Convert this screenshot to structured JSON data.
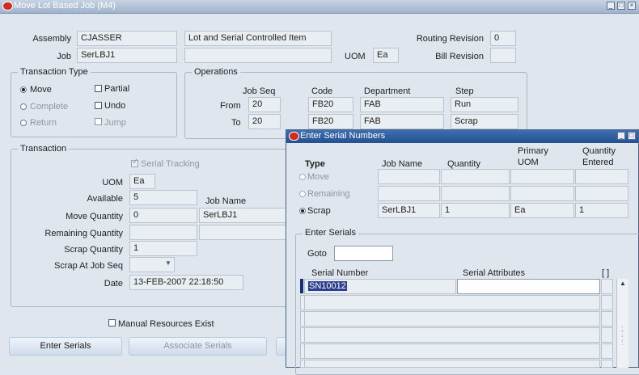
{
  "window": {
    "title": "Move Lot Based Job (M4)"
  },
  "header": {
    "assembly_label": "Assembly",
    "assembly_value": "CJASSER",
    "assembly_desc": "Lot and Serial Controlled Item",
    "job_label": "Job",
    "job_value": "SerLBJ1",
    "uom_label": "UOM",
    "uom_value": "Ea",
    "routing_revision_label": "Routing Revision",
    "routing_revision_value": "0",
    "bill_revision_label": "Bill Revision",
    "bill_revision_value": ""
  },
  "transaction_type": {
    "title": "Transaction Type",
    "move": "Move",
    "complete": "Complete",
    "return": "Return",
    "partial": "Partial",
    "undo": "Undo",
    "jump": "Jump",
    "selected": "Move"
  },
  "operations": {
    "title": "Operations",
    "headers": {
      "job_seq": "Job Seq",
      "code": "Code",
      "department": "Department",
      "step": "Step"
    },
    "from_label": "From",
    "to_label": "To",
    "from": {
      "job_seq": "20",
      "code": "FB20",
      "department": "FAB",
      "step": "Run"
    },
    "to": {
      "job_seq": "20",
      "code": "FB20",
      "department": "FAB",
      "step": "Scrap"
    }
  },
  "transaction": {
    "title": "Transaction",
    "serial_tracking": "Serial Tracking",
    "uom_label": "UOM",
    "uom_value": "Ea",
    "available_label": "Available",
    "available_value": "5",
    "job_name_label": "Job Name",
    "move_qty_label": "Move Quantity",
    "move_qty_value": "0",
    "move_job_name": "SerLBJ1",
    "remaining_qty_label": "Remaining Quantity",
    "remaining_qty_value": "",
    "scrap_qty_label": "Scrap Quantity",
    "scrap_qty_value": "1",
    "scrap_at_label": "Scrap At Job Seq",
    "scrap_at_value": "",
    "date_label": "Date",
    "date_value": "13-FEB-2007 22:18:50"
  },
  "manual_resources": "Manual Resources Exist",
  "buttons": {
    "enter_serials": "Enter Serials",
    "associate_serials": "Associate Serials"
  },
  "modal": {
    "title": "Enter Serial Numbers",
    "type_label": "Type",
    "headers": {
      "job_name": "Job Name",
      "quantity": "Quantity",
      "primary_uom_1": "Primary",
      "primary_uom_2": "UOM",
      "qty_entered_1": "Quantity",
      "qty_entered_2": "Entered"
    },
    "rows": [
      {
        "type": "Move",
        "job_name": "",
        "quantity": "",
        "uom": "",
        "entered": ""
      },
      {
        "type": "Remaining",
        "job_name": "",
        "quantity": "",
        "uom": "",
        "entered": ""
      },
      {
        "type": "Scrap",
        "job_name": "SerLBJ1",
        "quantity": "1",
        "uom": "Ea",
        "entered": "1"
      }
    ],
    "enter_serials_title": "Enter Serials",
    "goto_label": "Goto",
    "goto_value": "",
    "serial_number_header": "Serial Number",
    "serial_attributes_header": "Serial Attributes",
    "bracket_header": "[ ]",
    "serials": [
      "SN10012",
      "",
      "",
      "",
      "",
      ""
    ]
  }
}
